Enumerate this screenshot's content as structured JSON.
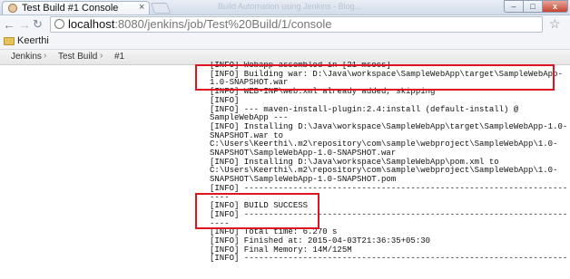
{
  "window": {
    "tab_title": "Test Build #1 Console",
    "tab_close": "×",
    "title_ghost": "Build Automation using Jenkins - Blog...",
    "min_label": "–",
    "max_label": "□",
    "close_label": "x"
  },
  "toolbar": {
    "url_host": "localhost",
    "url_path": ":8080/jenkins/job/Test%20Build/1/console"
  },
  "bookmarks": {
    "items": [
      {
        "label": "Keerthi"
      }
    ]
  },
  "breadcrumb": {
    "items": [
      {
        "label": "Jenkins"
      },
      {
        "label": "Test Build"
      },
      {
        "label": "#1"
      }
    ],
    "separator": "›"
  },
  "console": {
    "lines": [
      "[INFO] Webapp assembled in [21 msecs]",
      "[INFO] Building war: D:\\Java\\workspace\\SampleWebApp\\target\\SampleWebApp-",
      "1.0-SNAPSHOT.war",
      "[INFO] WEB-INF\\web.xml already added, skipping",
      "[INFO]",
      "[INFO] --- maven-install-plugin:2.4:install (default-install) @",
      "SampleWebApp ---",
      "[INFO] Installing D:\\Java\\workspace\\SampleWebApp\\target\\SampleWebApp-1.0-",
      "SNAPSHOT.war to",
      "C:\\Users\\Keerthi\\.m2\\repository\\com\\sample\\webproject\\SampleWebApp\\1.0-",
      "SNAPSHOT\\SampleWebApp-1.0-SNAPSHOT.war",
      "[INFO] Installing D:\\Java\\workspace\\SampleWebApp\\pom.xml to",
      "C:\\Users\\Keerthi\\.m2\\repository\\com\\sample\\webproject\\SampleWebApp\\1.0-",
      "SNAPSHOT\\SampleWebApp-1.0-SNAPSHOT.pom",
      "[INFO] ------------------------------------------------------------------",
      "----",
      "[INFO] BUILD SUCCESS",
      "[INFO] ------------------------------------------------------------------",
      "----",
      "[INFO] Total time: 6.270 s",
      "[INFO] Finished at: 2015-04-03T21:36:35+05:30",
      "[INFO] Final Memory: 14M/125M",
      "[INFO] ------------------------------------------------------------------"
    ]
  }
}
